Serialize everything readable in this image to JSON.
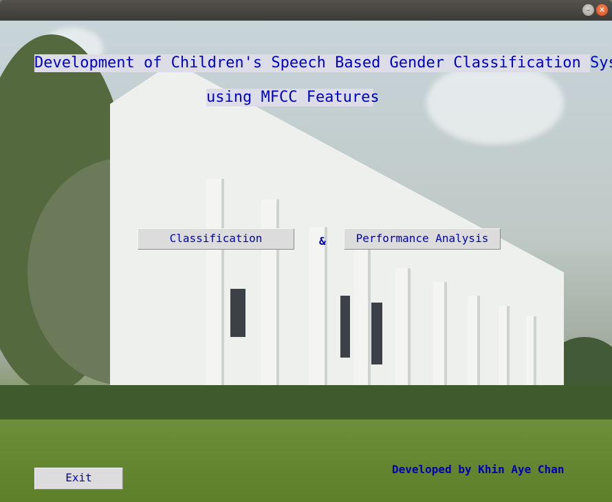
{
  "window": {
    "minimize_glyph": "–",
    "close_glyph": "✕"
  },
  "header": {
    "title_line1": "Development of Children's Speech Based Gender Classification System",
    "title_line2": "using MFCC Features"
  },
  "actions": {
    "classification_label": "Classification",
    "ampersand": "&",
    "performance_label": "Performance Analysis",
    "exit_label": "Exit"
  },
  "footer": {
    "credit": "Developed by Khin Aye Chan"
  },
  "colors": {
    "text_blue": "#0000c8",
    "label_bg": "#dddde7",
    "button_bg": "#dcdcdc"
  }
}
